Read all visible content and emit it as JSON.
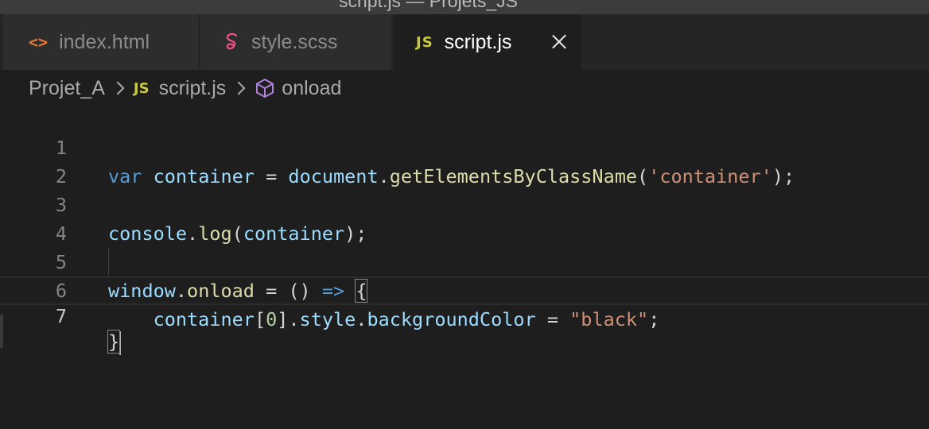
{
  "window": {
    "title": "script.js — Projets_JS"
  },
  "tabs": [
    {
      "label": "index.html",
      "icon": "html-icon",
      "active": false
    },
    {
      "label": "style.scss",
      "icon": "sass-icon",
      "active": false
    },
    {
      "label": "script.js",
      "icon": "js-icon",
      "active": true
    }
  ],
  "breadcrumb": {
    "folder": "Projet_A",
    "file_icon": "JS",
    "file": "script.js",
    "symbol": "onload"
  },
  "editor": {
    "lines": [
      {
        "number": "1",
        "text": "var container = document.getElementsByClassName('container');"
      },
      {
        "number": "2",
        "text": ""
      },
      {
        "number": "3",
        "text": "console.log(container);"
      },
      {
        "number": "4",
        "text": ""
      },
      {
        "number": "5",
        "text": "window.onload = () => {"
      },
      {
        "number": "6",
        "text": "    container[0].style.backgroundColor = \"black\";"
      },
      {
        "number": "7",
        "text": "}"
      }
    ],
    "current_line": "7"
  },
  "colors": {
    "keyword": "#569cd6",
    "variable": "#9cdcfe",
    "function": "#dcdcaa",
    "string": "#ce9178",
    "number": "#b5cea8",
    "js_icon": "#cbcb41",
    "html_icon": "#e37933",
    "sass_icon": "#f55385",
    "symbol_icon": "#b180d7"
  }
}
